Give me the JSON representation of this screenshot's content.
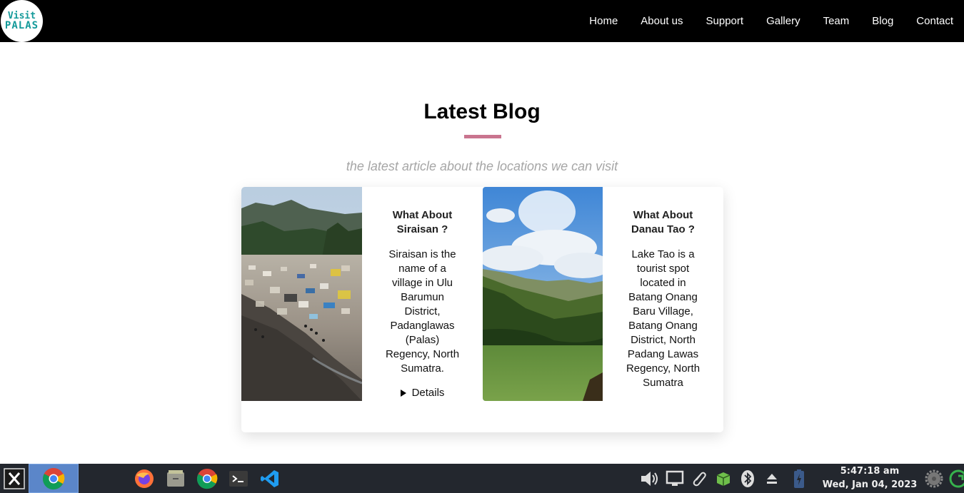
{
  "logo": {
    "line1": "Visit",
    "line2": "PALAS"
  },
  "nav": {
    "items": [
      "Home",
      "About us",
      "Support",
      "Gallery",
      "Team",
      "Blog",
      "Contact"
    ]
  },
  "section": {
    "title": "Latest Blog",
    "subtitle": "the latest article about the locations we can visit",
    "accent_color": "#c9748f"
  },
  "posts": [
    {
      "title": "What About Siraisan ?",
      "body": "Siraisan is the name of a village in Ulu Barumun District, Padanglawas (Palas) Regency, North Sumatra.",
      "details_label": "Details"
    },
    {
      "title": "What About Danau Tao ?",
      "body": "Lake Tao is a tourist spot located in Batang Onang Baru Village, Batang Onang District, North Padang Lawas Regency, North Sumatra"
    }
  ],
  "taskbar": {
    "apps": [
      "start-menu-icon",
      "chrome-icon",
      "firefox-icon",
      "files-icon",
      "chrome-icon",
      "terminal-icon",
      "vscode-icon"
    ],
    "tray": [
      "volume-icon",
      "display-icon",
      "paperclip-icon",
      "package-icon",
      "bluetooth-icon",
      "eject-icon",
      "battery-icon",
      "settings-icon",
      "update-icon"
    ],
    "time": "5:47:18 am",
    "date": "Wed, Jan 04, 2023"
  }
}
